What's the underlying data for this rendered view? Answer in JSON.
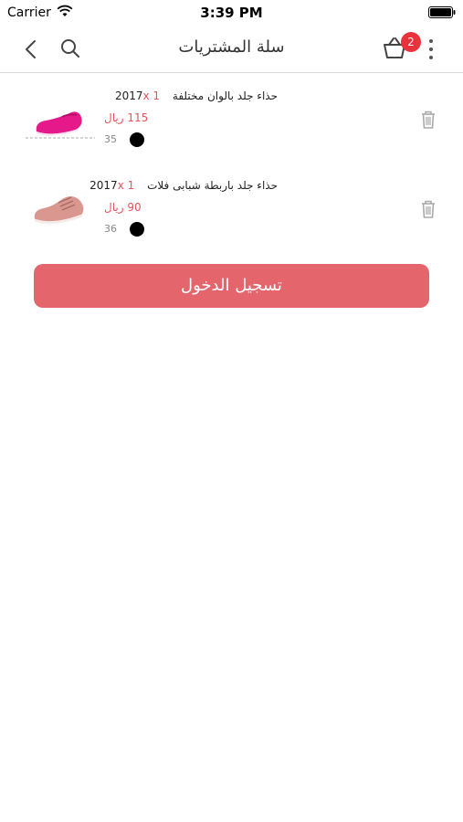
{
  "status_bar": {
    "carrier": "Carrier",
    "time": "3:39 PM"
  },
  "nav": {
    "title": "سلة المشتريات",
    "cart_badge": "2",
    "icons": [
      "chevron-left-icon",
      "search-icon",
      "basket-icon",
      "more-vertical-icon"
    ]
  },
  "cart": {
    "items": [
      {
        "title": "حذاء جلد بالوان مختلفة 2017",
        "quantity": "x 1",
        "price": "115 ريال",
        "size": "35",
        "color": "#000000",
        "image": "pink-slip-on-shoe"
      },
      {
        "title": "حذاء جلد باربطة شبابى فلات 2017",
        "quantity": "x 1",
        "price": "90 ريال",
        "size": "36",
        "color": "#000000",
        "image": "beige-lace-up-shoe"
      }
    ]
  },
  "actions": {
    "login_label": "تسجيل الدخول"
  },
  "colors": {
    "accent": "#e4666c",
    "badge": "#e8323c",
    "price": "#e8545a"
  }
}
